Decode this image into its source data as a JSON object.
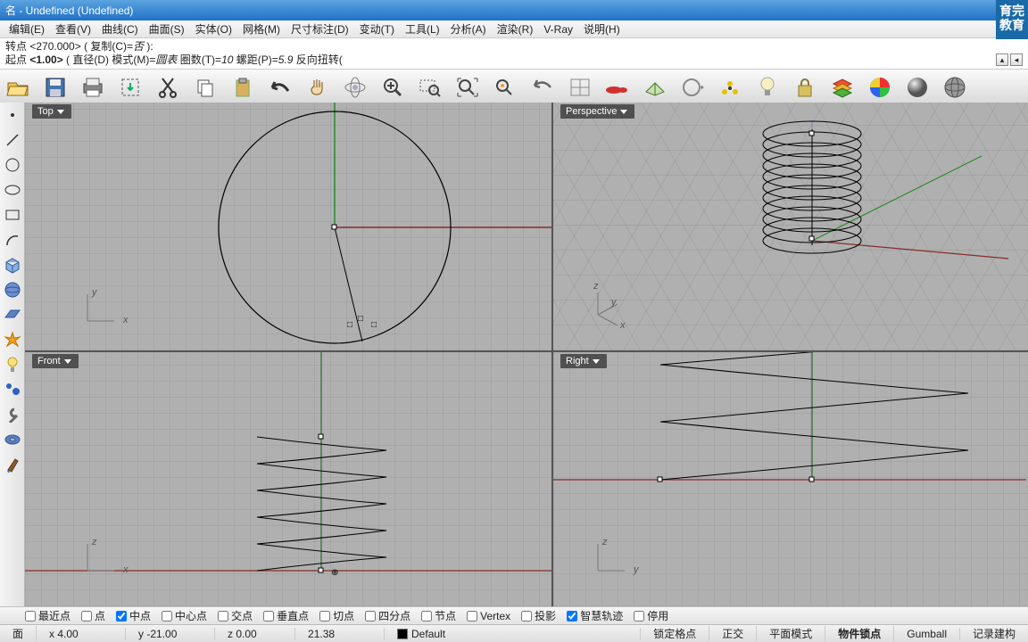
{
  "title": "名 - Undefined (Undefined)",
  "watermark": {
    "l1": "育完",
    "l2": "教育"
  },
  "menu": {
    "edit": "编辑(E)",
    "view": "查看(V)",
    "curve": "曲线(C)",
    "surface": "曲面(S)",
    "solid": "实体(O)",
    "mesh": "网格(M)",
    "dimension": "尺寸标注(D)",
    "transform": "变动(T)",
    "tools": "工具(L)",
    "analyze": "分析(A)",
    "render": "渲染(R)",
    "vray": "V-Ray",
    "help": "说明(H)"
  },
  "cmd": {
    "line1_a": "转点  <270.000>",
    "line1_b": " ( 复制(C)=",
    "line1_c": "否",
    "line1_d": " ):",
    "line2_a": "起点 ",
    "line2_b": "<1.00>",
    "line2_c": " ( 直径(D)  模式(M)=",
    "line2_d": "圆表",
    "line2_e": "  圈数(T)=",
    "line2_f": "10",
    "line2_g": "  螺距(P)=",
    "line2_h": "5.9",
    "line2_i": "  反向扭转("
  },
  "viewports": {
    "top": "Top",
    "perspective": "Perspective",
    "front": "Front",
    "right": "Right"
  },
  "osnap": {
    "near": "最近点",
    "point": "点",
    "mid": "中点",
    "center": "中心点",
    "intersect": "交点",
    "perp": "垂直点",
    "tan": "切点",
    "quad": "四分点",
    "knot": "节点",
    "vertex": "Vertex",
    "project": "投影",
    "smart": "智慧轨迹",
    "disable": "停用"
  },
  "status": {
    "face": "面",
    "x": "x 4.00",
    "y": "y -21.00",
    "z": "z 0.00",
    "w": "21.38",
    "layer": "Default",
    "gridlock": "锁定格点",
    "ortho": "正交",
    "planar": "平面模式",
    "osnap_b": "物件锁点",
    "gumball": "Gumball",
    "record": "记录建构"
  }
}
